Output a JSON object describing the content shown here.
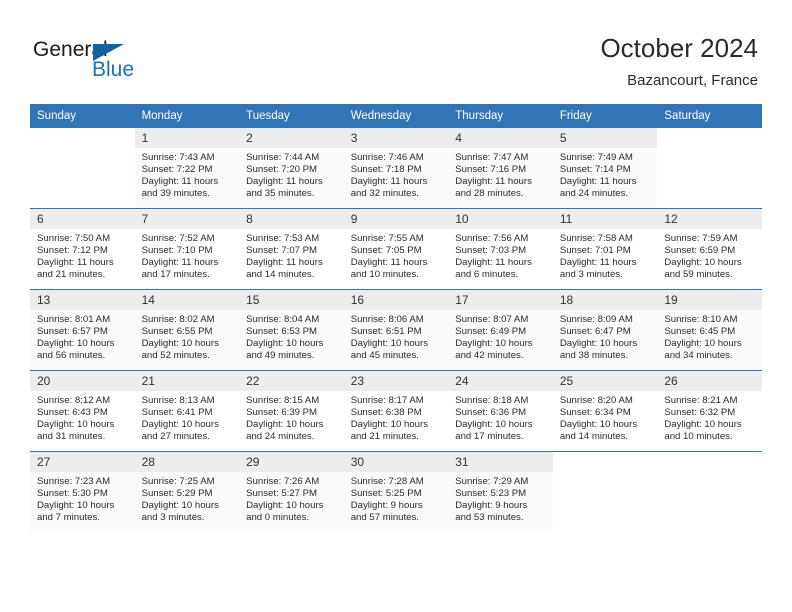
{
  "brand": {
    "word1": "General",
    "word2": "Blue",
    "triangle_color": "#14639e",
    "blue_color": "#1d6fb8",
    "logo_icon": "general-blue-logo-icon"
  },
  "header": {
    "title": "October 2024",
    "subtitle": "Bazancourt, France"
  },
  "theme": {
    "header_band": "#3175b4",
    "daynum_band": "#ededed",
    "row_shade": "#fafafa",
    "text": "#2b2b2b"
  },
  "columns": [
    "Sunday",
    "Monday",
    "Tuesday",
    "Wednesday",
    "Thursday",
    "Friday",
    "Saturday"
  ],
  "labels": {
    "sunrise_prefix": "Sunrise:",
    "sunset_prefix": "Sunset:",
    "daylight_prefix": "Daylight:"
  },
  "weeks": [
    {
      "shaded": true,
      "days": [
        {
          "empty": true
        },
        {
          "day": "1",
          "sunrise": "Sunrise: 7:43 AM",
          "sunset": "Sunset: 7:22 PM",
          "daylight_a": "Daylight: 11 hours",
          "daylight_b": "and 39 minutes."
        },
        {
          "day": "2",
          "sunrise": "Sunrise: 7:44 AM",
          "sunset": "Sunset: 7:20 PM",
          "daylight_a": "Daylight: 11 hours",
          "daylight_b": "and 35 minutes."
        },
        {
          "day": "3",
          "sunrise": "Sunrise: 7:46 AM",
          "sunset": "Sunset: 7:18 PM",
          "daylight_a": "Daylight: 11 hours",
          "daylight_b": "and 32 minutes."
        },
        {
          "day": "4",
          "sunrise": "Sunrise: 7:47 AM",
          "sunset": "Sunset: 7:16 PM",
          "daylight_a": "Daylight: 11 hours",
          "daylight_b": "and 28 minutes."
        },
        {
          "day": "5",
          "sunrise": "Sunrise: 7:49 AM",
          "sunset": "Sunset: 7:14 PM",
          "daylight_a": "Daylight: 11 hours",
          "daylight_b": "and 24 minutes."
        }
      ]
    },
    {
      "shaded": false,
      "days": [
        {
          "day": "6",
          "sunrise": "Sunrise: 7:50 AM",
          "sunset": "Sunset: 7:12 PM",
          "daylight_a": "Daylight: 11 hours",
          "daylight_b": "and 21 minutes."
        },
        {
          "day": "7",
          "sunrise": "Sunrise: 7:52 AM",
          "sunset": "Sunset: 7:10 PM",
          "daylight_a": "Daylight: 11 hours",
          "daylight_b": "and 17 minutes."
        },
        {
          "day": "8",
          "sunrise": "Sunrise: 7:53 AM",
          "sunset": "Sunset: 7:07 PM",
          "daylight_a": "Daylight: 11 hours",
          "daylight_b": "and 14 minutes."
        },
        {
          "day": "9",
          "sunrise": "Sunrise: 7:55 AM",
          "sunset": "Sunset: 7:05 PM",
          "daylight_a": "Daylight: 11 hours",
          "daylight_b": "and 10 minutes."
        },
        {
          "day": "10",
          "sunrise": "Sunrise: 7:56 AM",
          "sunset": "Sunset: 7:03 PM",
          "daylight_a": "Daylight: 11 hours",
          "daylight_b": "and 6 minutes."
        },
        {
          "day": "11",
          "sunrise": "Sunrise: 7:58 AM",
          "sunset": "Sunset: 7:01 PM",
          "daylight_a": "Daylight: 11 hours",
          "daylight_b": "and 3 minutes."
        },
        {
          "day": "12",
          "sunrise": "Sunrise: 7:59 AM",
          "sunset": "Sunset: 6:59 PM",
          "daylight_a": "Daylight: 10 hours",
          "daylight_b": "and 59 minutes."
        }
      ]
    },
    {
      "shaded": true,
      "days": [
        {
          "day": "13",
          "sunrise": "Sunrise: 8:01 AM",
          "sunset": "Sunset: 6:57 PM",
          "daylight_a": "Daylight: 10 hours",
          "daylight_b": "and 56 minutes."
        },
        {
          "day": "14",
          "sunrise": "Sunrise: 8:02 AM",
          "sunset": "Sunset: 6:55 PM",
          "daylight_a": "Daylight: 10 hours",
          "daylight_b": "and 52 minutes."
        },
        {
          "day": "15",
          "sunrise": "Sunrise: 8:04 AM",
          "sunset": "Sunset: 6:53 PM",
          "daylight_a": "Daylight: 10 hours",
          "daylight_b": "and 49 minutes."
        },
        {
          "day": "16",
          "sunrise": "Sunrise: 8:06 AM",
          "sunset": "Sunset: 6:51 PM",
          "daylight_a": "Daylight: 10 hours",
          "daylight_b": "and 45 minutes."
        },
        {
          "day": "17",
          "sunrise": "Sunrise: 8:07 AM",
          "sunset": "Sunset: 6:49 PM",
          "daylight_a": "Daylight: 10 hours",
          "daylight_b": "and 42 minutes."
        },
        {
          "day": "18",
          "sunrise": "Sunrise: 8:09 AM",
          "sunset": "Sunset: 6:47 PM",
          "daylight_a": "Daylight: 10 hours",
          "daylight_b": "and 38 minutes."
        },
        {
          "day": "19",
          "sunrise": "Sunrise: 8:10 AM",
          "sunset": "Sunset: 6:45 PM",
          "daylight_a": "Daylight: 10 hours",
          "daylight_b": "and 34 minutes."
        }
      ]
    },
    {
      "shaded": false,
      "days": [
        {
          "day": "20",
          "sunrise": "Sunrise: 8:12 AM",
          "sunset": "Sunset: 6:43 PM",
          "daylight_a": "Daylight: 10 hours",
          "daylight_b": "and 31 minutes."
        },
        {
          "day": "21",
          "sunrise": "Sunrise: 8:13 AM",
          "sunset": "Sunset: 6:41 PM",
          "daylight_a": "Daylight: 10 hours",
          "daylight_b": "and 27 minutes."
        },
        {
          "day": "22",
          "sunrise": "Sunrise: 8:15 AM",
          "sunset": "Sunset: 6:39 PM",
          "daylight_a": "Daylight: 10 hours",
          "daylight_b": "and 24 minutes."
        },
        {
          "day": "23",
          "sunrise": "Sunrise: 8:17 AM",
          "sunset": "Sunset: 6:38 PM",
          "daylight_a": "Daylight: 10 hours",
          "daylight_b": "and 21 minutes."
        },
        {
          "day": "24",
          "sunrise": "Sunrise: 8:18 AM",
          "sunset": "Sunset: 6:36 PM",
          "daylight_a": "Daylight: 10 hours",
          "daylight_b": "and 17 minutes."
        },
        {
          "day": "25",
          "sunrise": "Sunrise: 8:20 AM",
          "sunset": "Sunset: 6:34 PM",
          "daylight_a": "Daylight: 10 hours",
          "daylight_b": "and 14 minutes."
        },
        {
          "day": "26",
          "sunrise": "Sunrise: 8:21 AM",
          "sunset": "Sunset: 6:32 PM",
          "daylight_a": "Daylight: 10 hours",
          "daylight_b": "and 10 minutes."
        }
      ]
    },
    {
      "shaded": true,
      "days": [
        {
          "day": "27",
          "sunrise": "Sunrise: 7:23 AM",
          "sunset": "Sunset: 5:30 PM",
          "daylight_a": "Daylight: 10 hours",
          "daylight_b": "and 7 minutes."
        },
        {
          "day": "28",
          "sunrise": "Sunrise: 7:25 AM",
          "sunset": "Sunset: 5:29 PM",
          "daylight_a": "Daylight: 10 hours",
          "daylight_b": "and 3 minutes."
        },
        {
          "day": "29",
          "sunrise": "Sunrise: 7:26 AM",
          "sunset": "Sunset: 5:27 PM",
          "daylight_a": "Daylight: 10 hours",
          "daylight_b": "and 0 minutes."
        },
        {
          "day": "30",
          "sunrise": "Sunrise: 7:28 AM",
          "sunset": "Sunset: 5:25 PM",
          "daylight_a": "Daylight: 9 hours",
          "daylight_b": "and 57 minutes."
        },
        {
          "day": "31",
          "sunrise": "Sunrise: 7:29 AM",
          "sunset": "Sunset: 5:23 PM",
          "daylight_a": "Daylight: 9 hours",
          "daylight_b": "and 53 minutes."
        },
        {
          "empty": true
        },
        {
          "empty": true
        }
      ]
    }
  ]
}
